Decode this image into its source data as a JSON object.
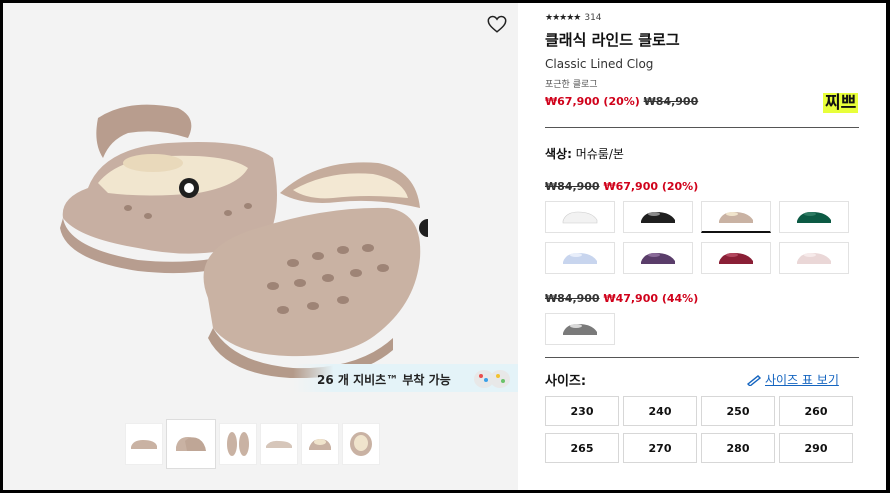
{
  "product": {
    "rating_count": "314",
    "title": "클래식 라인드 클로그",
    "subtitle": "Classic Lined Clog",
    "description": "포근한 클로그",
    "price_sale": "₩67,900 (20%)",
    "price_original": "₩84,900"
  },
  "note": "찌쁘",
  "color": {
    "label": "색상:",
    "value": "머슈룸/본"
  },
  "price_groups": [
    {
      "original": "₩84,900",
      "sale": "₩67,900 (20%)"
    },
    {
      "original": "₩84,900",
      "sale": "₩47,900 (44%)"
    }
  ],
  "swatch_colors": {
    "white": "#f2f2f2",
    "black": "#1f1f1f",
    "mushroom": "#c9b2a3",
    "green": "#0c5a44",
    "lightblue": "#c8d5ee",
    "purple": "#5a3d6a",
    "burgundy": "#8a1f36",
    "pink": "#ead7d7",
    "gray": "#7a7a7a"
  },
  "gallery": {
    "banner": "26 개 지비츠™ 부착 가능"
  },
  "size": {
    "label": "사이즈:",
    "guide": "사이즈 표 보기",
    "options": [
      "230",
      "240",
      "250",
      "260",
      "265",
      "270",
      "280",
      "290"
    ]
  }
}
